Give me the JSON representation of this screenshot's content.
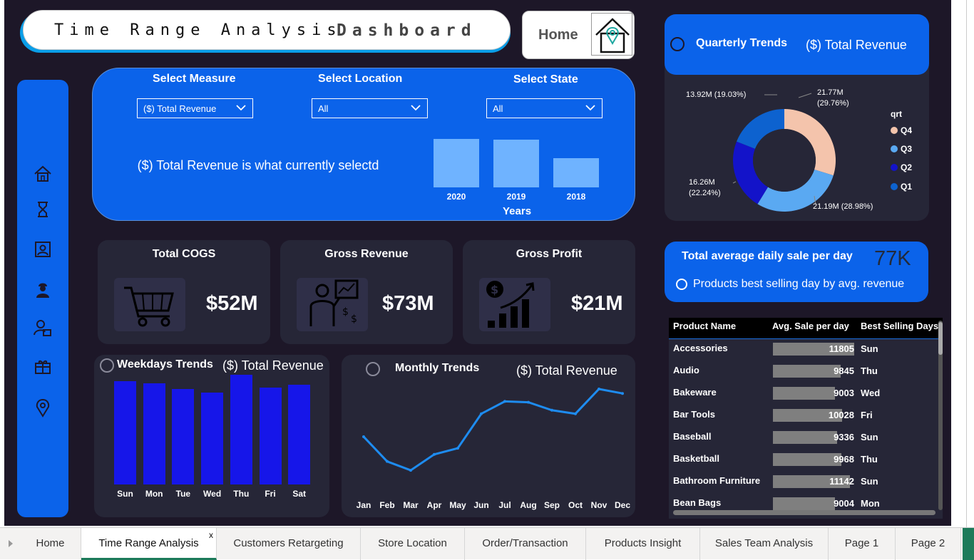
{
  "header": {
    "title_part1": "Time Range Analysis",
    "title_part2": "Dashboard",
    "home_label": "Home"
  },
  "filters": {
    "measure": {
      "label": "Select Measure",
      "value": "($) Total Revenue"
    },
    "location": {
      "label": "Select Location",
      "value": "All"
    },
    "state": {
      "label": "Select State",
      "value": "All"
    },
    "message": "($) Total Revenue is what  currently selectd"
  },
  "year_chart": {
    "xlabel": "Years",
    "categories": [
      "2020",
      "2019",
      "2018"
    ],
    "relative_values": [
      1.0,
      0.98,
      0.6
    ]
  },
  "kpis": [
    {
      "title": "Total COGS",
      "value": "$52M"
    },
    {
      "title": "Gross Revenue",
      "value": "$73M"
    },
    {
      "title": "Gross Profit",
      "value": "$21M"
    }
  ],
  "weekday_chart": {
    "title": "Weekdays Trends",
    "measure": "($) Total Revenue",
    "categories": [
      "Sun",
      "Mon",
      "Tue",
      "Wed",
      "Thu",
      "Fri",
      "Sat"
    ],
    "relative_values": [
      0.94,
      0.92,
      0.87,
      0.84,
      1.0,
      0.88,
      0.91
    ]
  },
  "monthly_chart": {
    "title": "Monthly Trends",
    "measure": "($) Total Revenue",
    "categories": [
      "Jan",
      "Feb",
      "Mar",
      "Apr",
      "May",
      "Jun",
      "Jul",
      "Aug",
      "Sep",
      "Oct",
      "Nov",
      "Dec"
    ],
    "relative_values": [
      0.46,
      0.18,
      0.08,
      0.26,
      0.33,
      0.72,
      0.86,
      0.85,
      0.76,
      0.72,
      1.0,
      0.95
    ]
  },
  "quarter_chart": {
    "title": "Quarterly Trends",
    "measure": "($) Total Revenue",
    "legend_title": "qrt",
    "legend": [
      "Q4",
      "Q3",
      "Q2",
      "Q1"
    ],
    "labels": {
      "q1": "13.92M (19.03%)",
      "q4": "21.77M (29.76%)",
      "q2": "16.26M (22.24%)",
      "q3": "21.19M (28.98%)"
    },
    "colors": {
      "Q4": "#f4c4ac",
      "Q3": "#5aa9f2",
      "Q2": "#1313c9",
      "Q1": "#0d62cf"
    }
  },
  "chart_data": {
    "type": "pie",
    "title": "Quarterly Trends",
    "categories": [
      "Q4",
      "Q3",
      "Q2",
      "Q1"
    ],
    "values": [
      21.77,
      21.19,
      16.26,
      13.92
    ],
    "percent": [
      29.76,
      28.98,
      22.24,
      19.03
    ]
  },
  "daily_sale": {
    "title": "Total average daily sale per day",
    "value": "77K",
    "subtitle": "Products best selling day by avg. revenue"
  },
  "product_table": {
    "columns": [
      "Product Name",
      "Avg. Sale per day",
      "Best Selling Days"
    ],
    "max_value": 11805,
    "rows": [
      {
        "name": "Accessories",
        "avg": 11805,
        "day": "Sun"
      },
      {
        "name": "Audio",
        "avg": 9845,
        "day": "Thu"
      },
      {
        "name": "Bakeware",
        "avg": 9003,
        "day": "Wed"
      },
      {
        "name": "Bar Tools",
        "avg": 10028,
        "day": "Fri"
      },
      {
        "name": "Baseball",
        "avg": 9336,
        "day": "Sun"
      },
      {
        "name": "Basketball",
        "avg": 9968,
        "day": "Thu"
      },
      {
        "name": "Bathroom Furniture",
        "avg": 11142,
        "day": "Sun"
      },
      {
        "name": "Bean Bags",
        "avg": 9004,
        "day": "Mon"
      }
    ]
  },
  "tabs": [
    {
      "label": "Home",
      "active": false,
      "close": ""
    },
    {
      "label": "Time Range Analysis",
      "active": true,
      "close": "x"
    },
    {
      "label": "Customers Retargeting",
      "active": false,
      "close": ""
    },
    {
      "label": "Store Location",
      "active": false,
      "close": ""
    },
    {
      "label": "Order/Transaction",
      "active": false,
      "close": ""
    },
    {
      "label": "Products Insight",
      "active": false,
      "close": ""
    },
    {
      "label": "Sales Team Analysis",
      "active": false,
      "close": ""
    },
    {
      "label": "Page 1",
      "active": false,
      "close": ""
    },
    {
      "label": "Page 2",
      "active": false,
      "close": ""
    }
  ]
}
